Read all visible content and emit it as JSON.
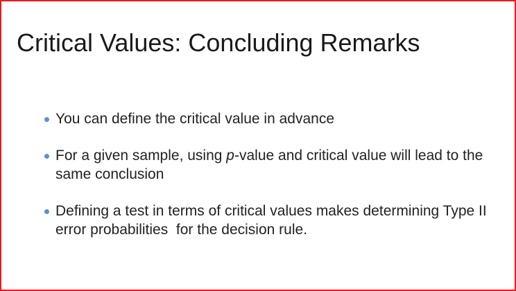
{
  "slide": {
    "title": "Critical Values: Concluding Remarks",
    "frame_color": "#e8191c",
    "bullet_color": "#5b8fd4",
    "bullets": [
      {
        "text": "You can define the critical value in advance"
      },
      {
        "prefix": "For a given sample, using ",
        "italic": "p",
        "suffix": "-value and critical value will lead to the same conclusion"
      },
      {
        "text": "Defining a test in terms of critical values makes determining Type II error probabilities  for the decision rule."
      }
    ]
  }
}
